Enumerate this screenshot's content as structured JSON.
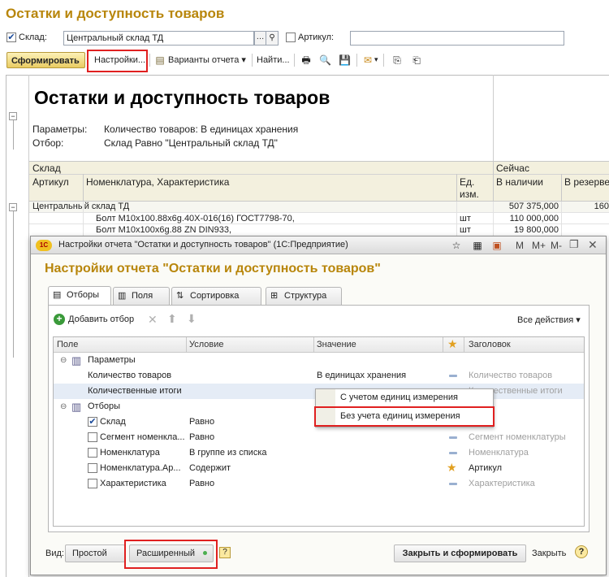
{
  "window_title": "Остатки и доступность товаров",
  "filters": {
    "warehouse_label": "Склад:",
    "warehouse_value": "Центральный склад ТД",
    "warehouse_checked": true,
    "article_label": "Артикул:",
    "article_value": "",
    "article_checked": false
  },
  "toolbar": {
    "generate": "Сформировать",
    "settings": "Настройки...",
    "variants": "Варианты отчета",
    "find": "Найти..."
  },
  "report": {
    "title": "Остатки и доступность товаров",
    "params_label": "Параметры:",
    "params_value": "Количество товаров: В единицах хранения",
    "filter_label": "Отбор:",
    "filter_value": "Склад Равно \"Центральный склад ТД\"",
    "col_warehouse": "Склад",
    "col_now": "Сейчас",
    "col_article": "Артикул",
    "col_nomenclature": "Номенклатура, Характеристика",
    "col_unit": "Ед. изм.",
    "col_available": "В наличии",
    "col_reserve": "В резерве",
    "rows": [
      {
        "name": "Центральный склад ТД",
        "unit": "",
        "available": "507 375,000",
        "reserve": "160"
      },
      {
        "name": "Болт М10х100.88х6g.40Х-016(16) ГОСТ7798-70,",
        "unit": "шт",
        "available": "110 000,000",
        "reserve": ""
      },
      {
        "name": "Болт М10х100х6g.88 ZN DIN933,",
        "unit": "шт",
        "available": "19 800,000",
        "reserve": ""
      }
    ]
  },
  "dialog": {
    "window_title": "Настройки отчета \"Остатки и доступность товаров\"  (1С:Предприятие)",
    "title": "Настройки отчета \"Остатки и доступность товаров\"",
    "title_buttons": [
      "M",
      "M+",
      "M-"
    ],
    "tabs": [
      "Отборы",
      "Поля",
      "Сортировка",
      "Структура"
    ],
    "add_filter": "Добавить отбор",
    "all_actions": "Все действия",
    "columns": {
      "field": "Поле",
      "condition": "Условие",
      "value": "Значение",
      "header": "Заголовок"
    },
    "rows": [
      {
        "field": "Параметры",
        "condition": "",
        "value": "",
        "header": ""
      },
      {
        "field": "Количество товаров",
        "condition": "",
        "value": "В единицах хранения",
        "header": "Количество товаров"
      },
      {
        "field": "Количественные итоги",
        "condition": "",
        "value": "",
        "header": "Количественные итоги"
      },
      {
        "field": "Отборы",
        "condition": "",
        "value": "",
        "header": ""
      },
      {
        "field": "Склад",
        "condition": "Равно",
        "value": "",
        "header": "Склад"
      },
      {
        "field": "Сегмент номенкла...",
        "condition": "Равно",
        "value": "",
        "header": "Сегмент номенклатуры"
      },
      {
        "field": "Номенклатура",
        "condition": "В группе из списка",
        "value": "",
        "header": "Номенклатура"
      },
      {
        "field": "Номенклатура.Ар...",
        "condition": "Содержит",
        "value": "",
        "header": "Артикул"
      },
      {
        "field": "Характеристика",
        "condition": "Равно",
        "value": "",
        "header": "Характеристика"
      }
    ],
    "dropdown": [
      "С учетом единиц измерения",
      "Без учета единиц измерения"
    ],
    "view_label": "Вид:",
    "view_simple": "Простой",
    "view_extended": "Расширенный",
    "help_q": "?",
    "close_generate": "Закрыть и сформировать",
    "close": "Закрыть"
  }
}
